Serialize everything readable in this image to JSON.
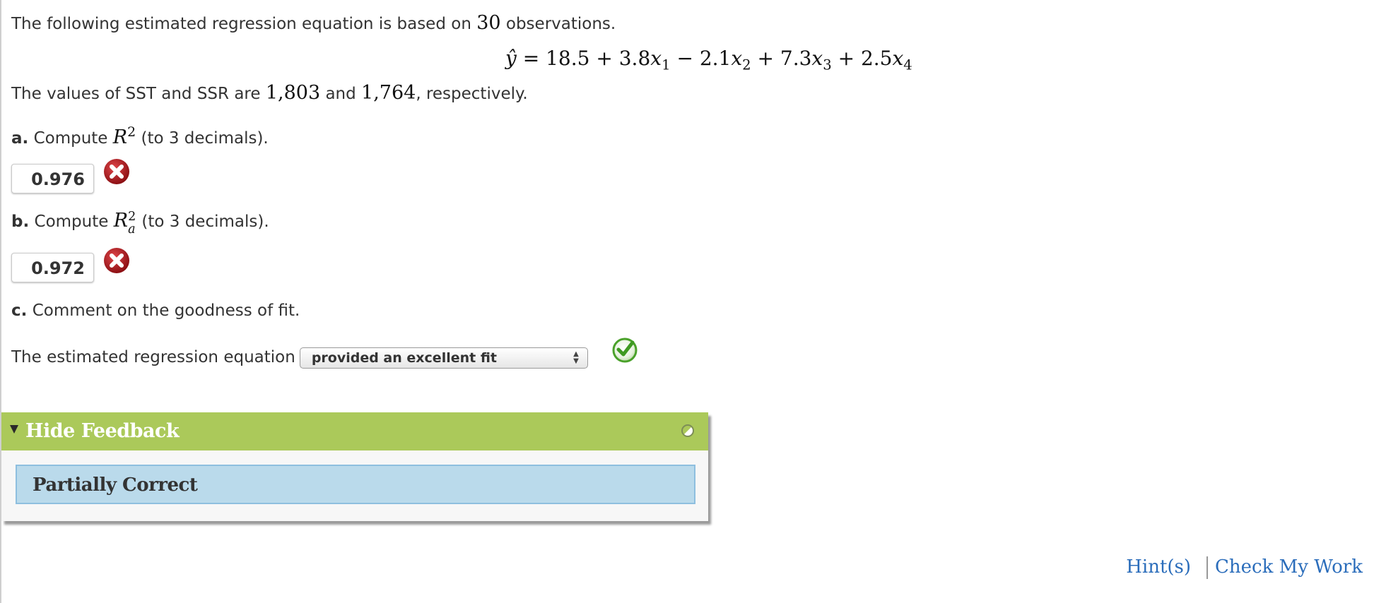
{
  "problem": {
    "intro_prefix": "The following estimated regression equation is based on",
    "observations": "30",
    "intro_suffix": "observations.",
    "equation": {
      "lhs": "ŷ",
      "equals": "=",
      "intercept": "18.5",
      "terms": [
        {
          "sign": "+",
          "coef": "3.8",
          "var": "x",
          "sub": "1"
        },
        {
          "sign": "−",
          "coef": "2.1",
          "var": "x",
          "sub": "2"
        },
        {
          "sign": "+",
          "coef": "7.3",
          "var": "x",
          "sub": "3"
        },
        {
          "sign": "+",
          "coef": "2.5",
          "var": "x",
          "sub": "4"
        }
      ]
    },
    "sst_prefix": "The values of SST and SSR are",
    "sst": "1,803",
    "and": "and",
    "ssr": "1,764",
    "sst_suffix": ", respectively."
  },
  "parts": {
    "a": {
      "letter": "a.",
      "text_before": "Compute",
      "symbol": "R",
      "sup": "2",
      "text_after": "(to 3 decimals).",
      "answer": "0.976",
      "status": "incorrect",
      "status_icon": "x-circle-icon"
    },
    "b": {
      "letter": "b.",
      "text_before": "Compute",
      "symbol": "R",
      "sup": "2",
      "sub": "a",
      "text_after": "(to 3 decimals).",
      "answer": "0.972",
      "status": "incorrect",
      "status_icon": "x-circle-icon"
    },
    "c": {
      "letter": "c.",
      "text": "Comment on the goodness of fit.",
      "answer_prefix": "The estimated regression equation",
      "selected_option": "provided an excellent fit",
      "answer_suffix": ".",
      "status": "correct",
      "status_icon": "check-circle-icon"
    }
  },
  "feedback": {
    "toggle_label": "Hide Feedback",
    "status_text": "Partially Correct",
    "header_color": "#abc95a",
    "body_color": "#badaeb"
  },
  "footer": {
    "hints_label": "Hint(s)",
    "check_label": "Check My Work",
    "link_color": "#2b6dbb"
  },
  "colors": {
    "incorrect": "#b0191d",
    "correct": "#4aa12a"
  }
}
